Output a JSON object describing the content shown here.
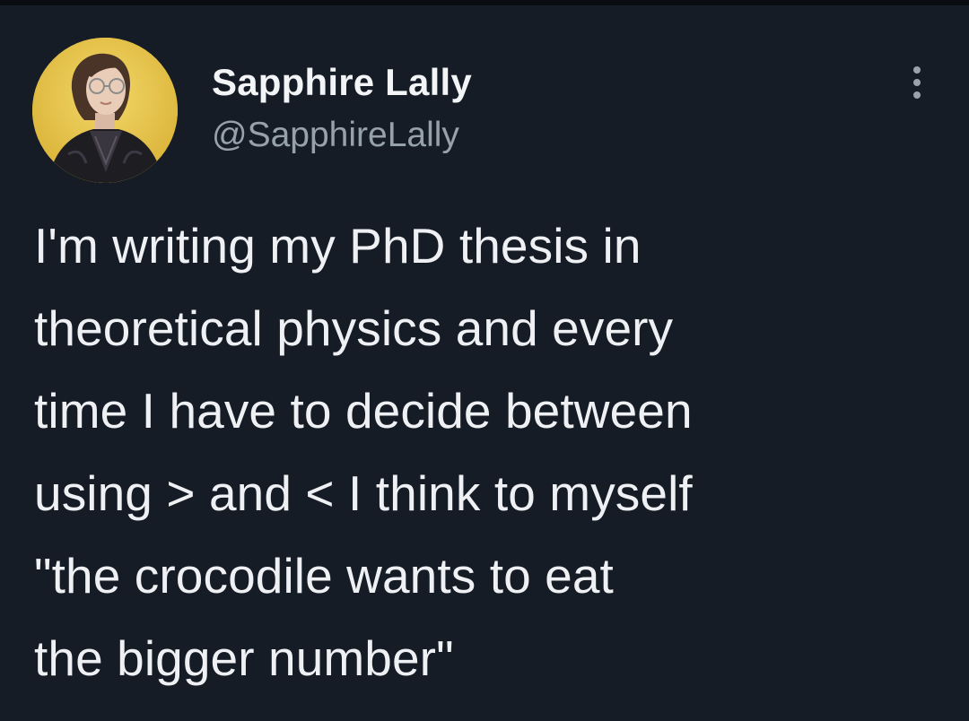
{
  "colors": {
    "background": "#151c26",
    "text": "#eef0f3",
    "handle": "#97a1ac",
    "avatar_bg": "#e7c34a"
  },
  "author": {
    "display_name": "Sapphire Lally",
    "handle": "@SapphireLally",
    "avatar_icon": "profile-photo"
  },
  "menu": {
    "icon": "more-vertical-icon"
  },
  "tweet": {
    "text": "I'm writing my PhD thesis in\ntheoretical physics and every\ntime I have to decide between\nusing > and < I think to myself\n\"the crocodile wants to eat\nthe bigger number\""
  }
}
